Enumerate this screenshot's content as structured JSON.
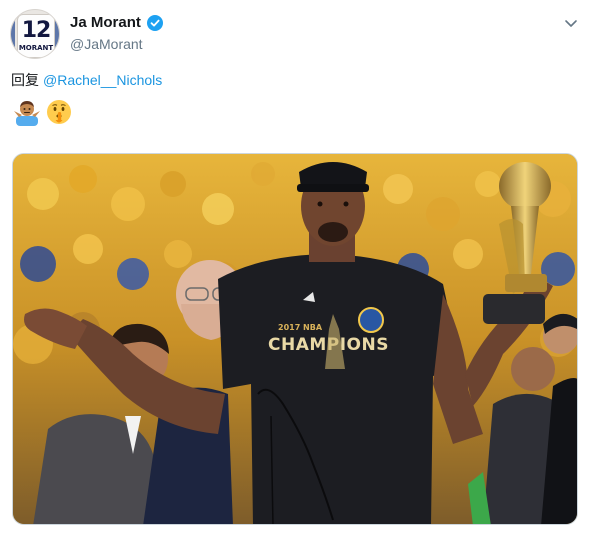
{
  "tweet": {
    "author": {
      "display_name": "Ja Morant",
      "handle": "@JaMorant",
      "avatar_icon": "jersey-12-avatar-icon",
      "avatar_jersey_number": "12",
      "avatar_jersey_name": "MORANT",
      "verified": true
    },
    "reply_prefix": "回复",
    "reply_to": "@Rachel__Nichols",
    "emojis": [
      "man-shrugging-emoji",
      "shushing-face-emoji"
    ],
    "menu_icon": "chevron-down-icon",
    "photo": {
      "shirt_text": "CHAMPIONS",
      "shirt_small_text": "2017 NBA"
    }
  },
  "colors": {
    "link": "#1b95e0",
    "verified": "#1da1f2",
    "handle": "#657786",
    "crowd_gold": "#d9a52c",
    "shirt": "#1c1d22"
  }
}
